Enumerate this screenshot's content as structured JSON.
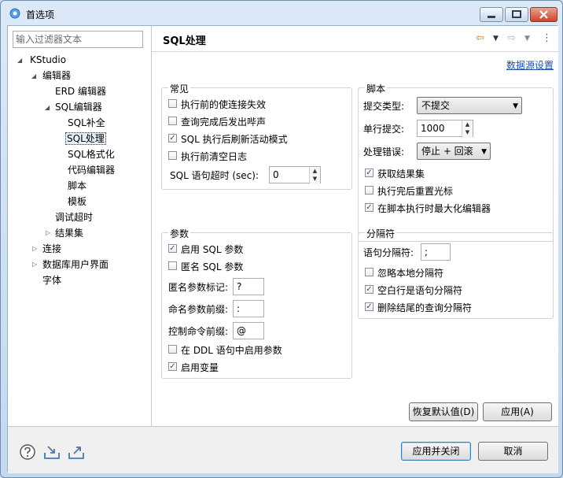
{
  "window": {
    "title": "首选项"
  },
  "filter": {
    "placeholder": "输入过滤器文本"
  },
  "tree": {
    "root": "KStudio",
    "editors": "编辑器",
    "erd_editor": "ERD 编辑器",
    "sql_editor": "SQL编辑器",
    "sql_complete": "SQL补全",
    "sql_processing": "SQL处理",
    "sql_format": "SQL格式化",
    "code_editor": "代码编辑器",
    "script": "脚本",
    "template": "模板",
    "debug_timeout": "调试超时",
    "result_set": "结果集",
    "connection": "连接",
    "db_ui": "数据库用户界面",
    "font": "字体"
  },
  "page": {
    "title": "SQL处理",
    "datasource_link": "数据源设置"
  },
  "common": {
    "title": "常见",
    "test_connection": {
      "label": "执行前的使连接失效",
      "checked": false
    },
    "beep": {
      "label": "查询完成后发出哔声",
      "checked": false
    },
    "refresh_active": {
      "label": "SQL 执行后刷新活动模式",
      "checked": true
    },
    "clear_log": {
      "label": "执行前清空日志",
      "checked": false
    },
    "timeout_label": "SQL 语句超时 (sec):",
    "timeout_value": "0"
  },
  "script": {
    "title": "脚本",
    "commit_type_label": "提交类型:",
    "commit_type_value": "不提交",
    "single_commit_label": "单行提交:",
    "single_commit_value": "1000",
    "error_label": "处理错误:",
    "error_value": "停止 + 回滚",
    "fetch_results": {
      "label": "获取结果集",
      "checked": true
    },
    "reset_cursor": {
      "label": "执行完后重置光标",
      "checked": false
    },
    "maximize_editor": {
      "label": "在脚本执行时最大化编辑器",
      "checked": true
    }
  },
  "params": {
    "title": "参数",
    "enable_sql_params": {
      "label": "启用 SQL 参数",
      "checked": true
    },
    "anon_sql_params": {
      "label": "匿名 SQL 参数",
      "checked": false
    },
    "anon_marker_label": "匿名参数标记:",
    "anon_marker_value": "?",
    "named_prefix_label": "命名参数前缀:",
    "named_prefix_value": ":",
    "control_prefix_label": "控制命令前缀:",
    "control_prefix_value": "@",
    "ddl_params": {
      "label": "在 DDL 语句中启用参数",
      "checked": false
    },
    "enable_vars": {
      "label": "启用变量",
      "checked": true
    }
  },
  "delimiter": {
    "title": "分隔符",
    "stmt_delim_label": "语句分隔符:",
    "stmt_delim_value": ";",
    "ignore_native": {
      "label": "忽略本地分隔符",
      "checked": false
    },
    "blank_line": {
      "label": "空白行是语句分隔符",
      "checked": true
    },
    "remove_trailing": {
      "label": "删除结尾的查询分隔符",
      "checked": true
    }
  },
  "buttons": {
    "restore_defaults": "恢复默认值(D)",
    "apply": "应用(A)",
    "apply_close": "应用并关闭",
    "cancel": "取消"
  },
  "check_glyph": "✓",
  "colors": {
    "link": "#1a4fa7",
    "accent": "#3c7fb1",
    "close_button": "#c9442a"
  }
}
